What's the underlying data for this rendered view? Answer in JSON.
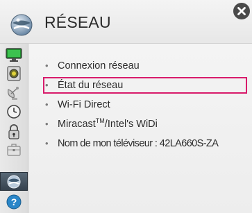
{
  "header": {
    "title": "RÉSEAU",
    "icon": "globe-network-icon"
  },
  "sidebar": {
    "items": [
      {
        "icon": "picture-monitor-icon",
        "active": false
      },
      {
        "icon": "speaker-icon",
        "active": false
      },
      {
        "icon": "satellite-dish-icon",
        "active": false
      },
      {
        "icon": "clock-icon",
        "active": false
      },
      {
        "icon": "lock-icon",
        "active": false
      },
      {
        "icon": "briefcase-icon",
        "active": false
      },
      {
        "icon": "globe-network-icon",
        "active": true
      },
      {
        "icon": "help-icon",
        "active": false
      }
    ]
  },
  "menu": {
    "items": [
      {
        "label": "Connexion réseau",
        "focused": false
      },
      {
        "label": "État du réseau",
        "focused": true
      },
      {
        "label": "Wi-Fi Direct",
        "focused": false
      },
      {
        "label_main": "Miracast",
        "label_tm": "TM",
        "label_rest": "/Intel's WiDi",
        "focused": false
      },
      {
        "label": "Nom de mon téléviseur : 42LA660S-ZA",
        "focused": false
      }
    ],
    "bullet": "•"
  },
  "colors": {
    "focus_border": "#d81b6b",
    "active_tab": "#3d4955"
  }
}
